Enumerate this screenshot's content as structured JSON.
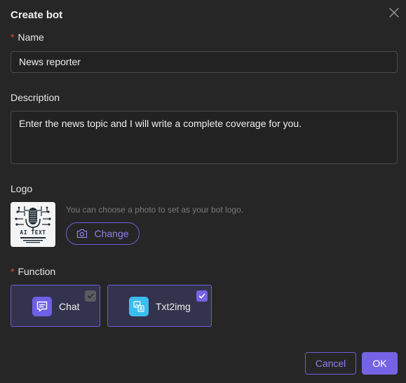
{
  "dialog": {
    "title": "Create bot",
    "close_icon": "close-icon"
  },
  "form": {
    "name": {
      "label": "Name",
      "required_mark": "*",
      "value": "News reporter"
    },
    "description": {
      "label": "Description",
      "value": "Enter the news topic and I will write a complete coverage for you."
    },
    "logo": {
      "label": "Logo",
      "hint": "You can choose a photo to set as your bot logo.",
      "change_label": "Change",
      "change_icon": "camera-icon",
      "image_text": "AI TEXT"
    },
    "function": {
      "label": "Function",
      "required_mark": "*",
      "options": [
        {
          "label": "Chat",
          "icon": "chat-icon",
          "checked": true,
          "check_style": "gray"
        },
        {
          "label": "Txt2img",
          "icon": "image-translate-icon",
          "checked": true,
          "check_style": "purple"
        }
      ]
    }
  },
  "footer": {
    "cancel_label": "Cancel",
    "ok_label": "OK"
  },
  "colors": {
    "accent": "#7563e6",
    "required": "#e5484d",
    "background": "#262626"
  }
}
